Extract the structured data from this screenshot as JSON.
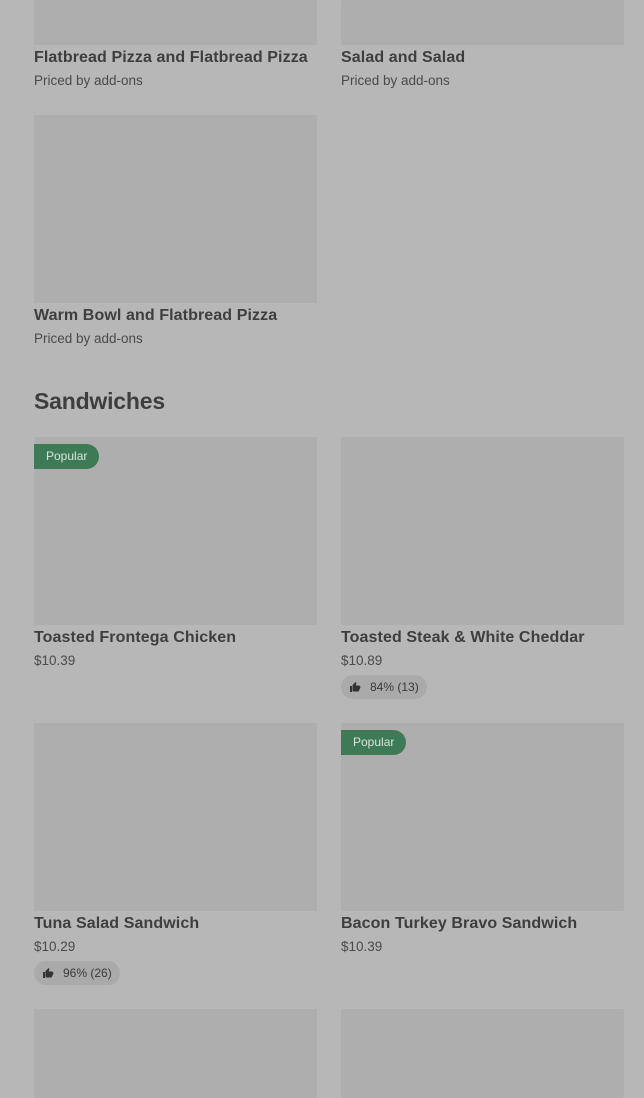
{
  "cards_top": [
    {
      "name": "Flatbread Pizza and Flatbread Pizza",
      "price": "Priced by add-ons"
    },
    {
      "name": "Salad and Salad",
      "price": "Priced by add-ons"
    },
    {
      "name": "Warm Bowl and Flatbread Pizza",
      "price": "Priced by add-ons"
    }
  ],
  "section": {
    "title": "Sandwiches"
  },
  "popular_label": "Popular",
  "sandwiches": [
    {
      "name": "Toasted Frontega Chicken",
      "price": "$10.39",
      "popular": true
    },
    {
      "name": "Toasted Steak & White Cheddar",
      "price": "$10.89",
      "rating": "84% (13)"
    },
    {
      "name": "Tuna Salad Sandwich",
      "price": "$10.29",
      "rating": "96% (26)"
    },
    {
      "name": "Bacon Turkey Bravo Sandwich",
      "price": "$10.39",
      "popular": true
    }
  ],
  "icons": {
    "rating": "thumbs-up-icon"
  }
}
